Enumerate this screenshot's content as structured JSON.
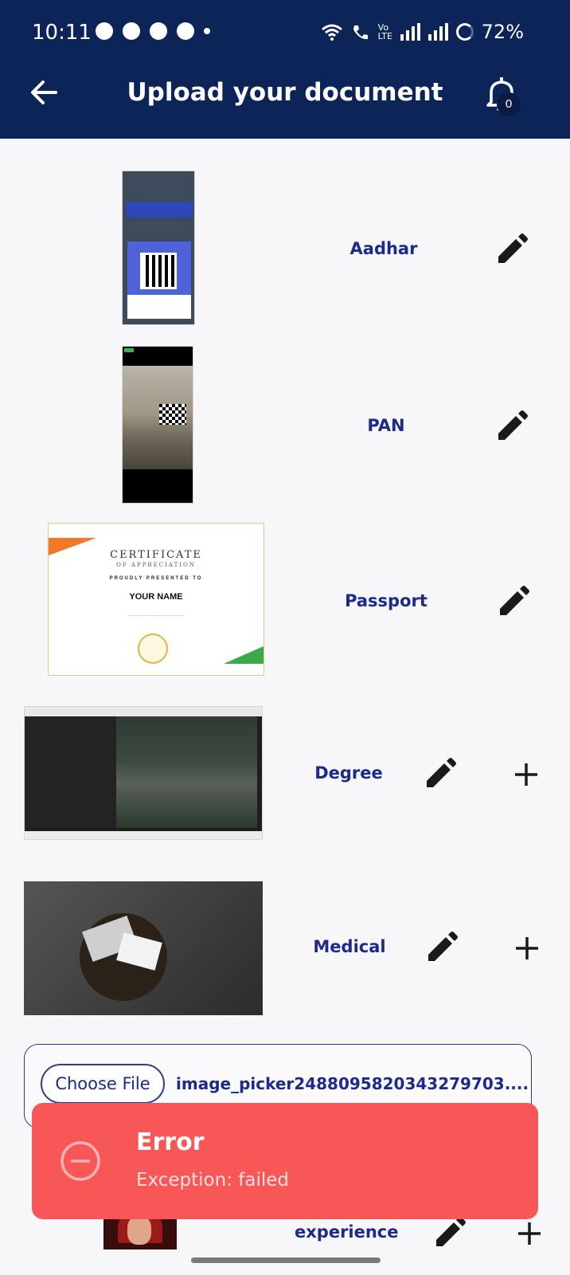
{
  "status_bar": {
    "time": "10:11",
    "battery": "72%",
    "network": "Vo LTE"
  },
  "header": {
    "title": "Upload your document",
    "notification_count": "0"
  },
  "documents": [
    {
      "label": "Aadhar",
      "has_add": false,
      "thumbnail": "phone-qr-screenshot"
    },
    {
      "label": "PAN",
      "has_add": false,
      "thumbnail": "room-photo"
    },
    {
      "label": "Passport",
      "has_add": false,
      "thumbnail": "certificate-image"
    },
    {
      "label": "Degree",
      "has_add": true,
      "thumbnail": "desktop-screenshot"
    },
    {
      "label": "Medical",
      "has_add": true,
      "thumbnail": "office-desk-photo"
    },
    {
      "label": "experience",
      "has_add": true,
      "thumbnail": "avatar-image"
    }
  ],
  "certificate_thumb": {
    "title": "CERTIFICATE",
    "subtitle": "OF APPRECIATION",
    "presented": "PROUDLY PRESENTED TO",
    "name": "YOUR NAME"
  },
  "file_picker": {
    "button_label": "Choose File",
    "file_name": "image_picker2488095820343279703...."
  },
  "toast": {
    "title": "Error",
    "message": "Exception: failed",
    "color": "#f75757"
  },
  "colors": {
    "header_bg": "#0d2459",
    "label_text": "#1b2a8c"
  }
}
